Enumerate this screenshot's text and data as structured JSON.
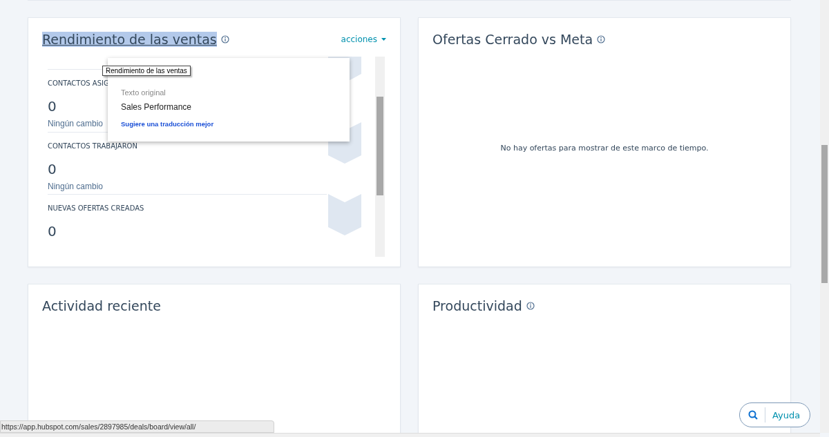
{
  "sales_card": {
    "title": "Rendimiento de las ventas",
    "title_selected": true,
    "actions": "acciones",
    "metrics": [
      {
        "label": "CONTACTOS ASIG",
        "value": "0",
        "change": "Ningún cambio"
      },
      {
        "label": "CONTACTOS TRABAJARON",
        "value": "0",
        "change": "Ningún cambio"
      },
      {
        "label": "NUEVAS OFERTAS CREADAS",
        "value": "0"
      }
    ]
  },
  "deals_card": {
    "title": "Ofertas Cerrado vs Meta",
    "empty_message": "No hay ofertas para mostrar de este marco de tiempo."
  },
  "activity_card": {
    "title": "Actividad reciente"
  },
  "productivity_card": {
    "title": "Productividad"
  },
  "translate_popup": {
    "heading": "Texto original",
    "original": "Sales Performance",
    "link": "Sugiere una traducción mejor"
  },
  "tooltip": "Rendimiento de las ventas",
  "help_button": {
    "label": "Ayuda"
  },
  "status_url": "https://app.hubspot.com/sales/2897985/deals/board/view/all/"
}
